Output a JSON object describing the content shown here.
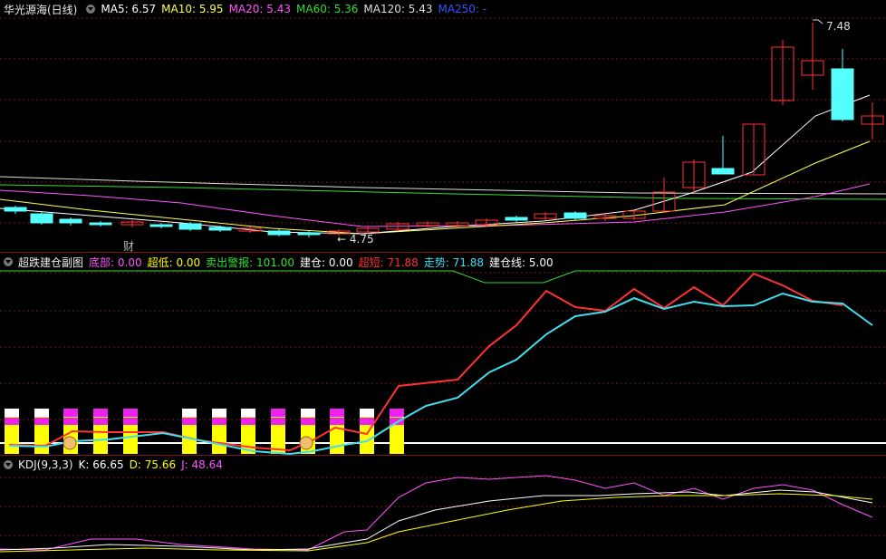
{
  "main": {
    "title": "华光源海(日线)",
    "ma": [
      {
        "label": "MA5: 6.57",
        "color": "#ffffff"
      },
      {
        "label": "MA10: 5.95",
        "color": "#ffff55"
      },
      {
        "label": "MA20: 5.43",
        "color": "#ff55ff"
      },
      {
        "label": "MA60: 5.36",
        "color": "#33dd33"
      },
      {
        "label": "MA120: 5.43",
        "color": "#dddddd"
      },
      {
        "label": "MA250: -",
        "color": "#3355ff"
      }
    ],
    "high_label": "7.48",
    "low_label": "4.75",
    "cai_label": "财"
  },
  "sub": {
    "title": "超跌建仓副图",
    "values": [
      {
        "label": "底部: 0.00",
        "color": "#ff55ff"
      },
      {
        "label": "超低: 0.00",
        "color": "#ffff00"
      },
      {
        "label": "卖出警报: 101.00",
        "color": "#33dd33"
      },
      {
        "label": "建仓: 0.00",
        "color": "#ffffff"
      },
      {
        "label": "超短: 71.88",
        "color": "#ff3333"
      },
      {
        "label": "走势: 71.88",
        "color": "#44ddee"
      },
      {
        "label": "建仓线: 5.00",
        "color": "#ffffff"
      }
    ]
  },
  "kdj": {
    "title": "KDJ(9,3,3)",
    "values": [
      {
        "label": "K: 66.65",
        "color": "#ffffff"
      },
      {
        "label": "D: 75.66",
        "color": "#ffff00"
      },
      {
        "label": "J: 48.64",
        "color": "#ff55ff"
      }
    ]
  },
  "colors": {
    "up": "#ff3333",
    "down": "#55ffff",
    "grid": "#7a1a1a"
  }
}
